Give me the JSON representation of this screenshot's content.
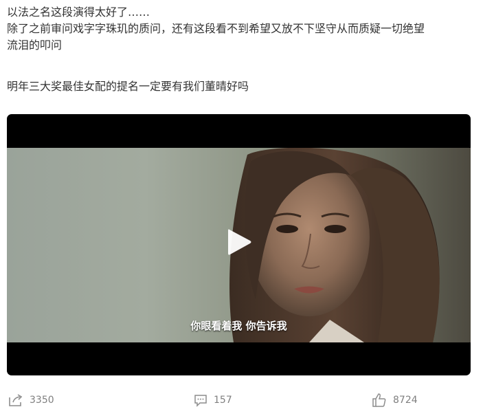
{
  "post": {
    "lines": [
      "以法之名这段演得太好了……",
      "除了之前审问戏字字珠玑的质问，还有这段看不到希望又放不下坚守从而质疑一切绝望",
      "流泪的叩问",
      "明年三大奖最佳女配的提名一定要有我们董晴好吗"
    ]
  },
  "video": {
    "subtitle": "你眼看着我 你告诉我",
    "play_icon": "play-icon"
  },
  "actions": {
    "share_count": "3350",
    "comment_count": "157",
    "like_count": "8724",
    "share_icon": "share-icon",
    "comment_icon": "comment-icon",
    "like_icon": "thumbs-up-icon"
  }
}
